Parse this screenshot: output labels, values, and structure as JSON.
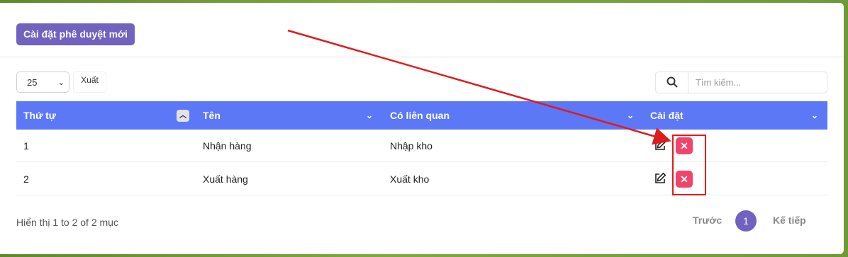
{
  "toolbar": {
    "new_button": "Cài đặt phê duyệt mới"
  },
  "controls": {
    "page_size": "25",
    "export_label": "Xuất",
    "search_placeholder": "Tìm kiếm..."
  },
  "table": {
    "columns": [
      "Thứ tự",
      "Tên",
      "Có liên quan",
      "Cài đặt"
    ],
    "rows": [
      {
        "order": "1",
        "name": "Nhận hàng",
        "related": "Nhập kho"
      },
      {
        "order": "2",
        "name": "Xuất hàng",
        "related": "Xuất kho"
      }
    ]
  },
  "footer": {
    "info": "Hiển thị 1 to 2 of 2 mục",
    "prev": "Trước",
    "current_page": "1",
    "next": "Kế tiếp"
  },
  "colors": {
    "accent": "#7062be",
    "header": "#5c78f7",
    "delete": "#f2436a",
    "annotation": "#e01b1b"
  },
  "icons": [
    "search-icon",
    "chevron-down-icon",
    "sort-up-icon",
    "edit-icon",
    "close-icon"
  ]
}
